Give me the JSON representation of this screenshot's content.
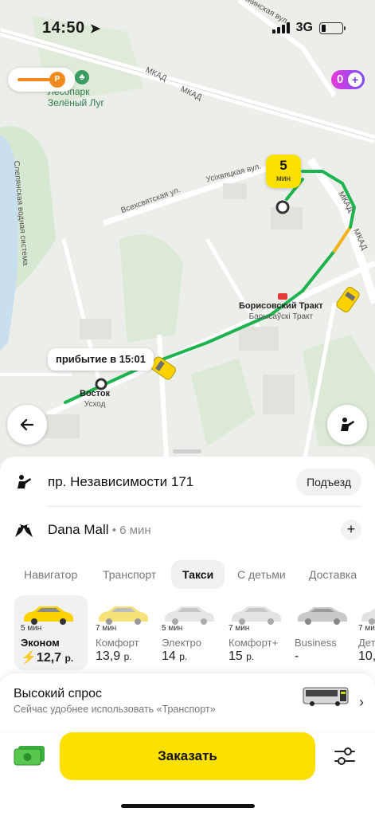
{
  "status": {
    "time": "14:50",
    "network": "3G"
  },
  "map": {
    "park_name_line1": "Лесопарк",
    "park_name_line2": "Зелёный Луг",
    "road_labels": {
      "mkad1": "МКАД",
      "mkad2": "МКАД",
      "mkad3": "МКАД",
      "mkad4": "МКАД",
      "usikh": "Усіхвяцкая вул.",
      "vsekh": "Всехсвятская ул.",
      "slep": "Слепянская водная система",
      "top_street": "Минская вул."
    },
    "parking_badge": "Р",
    "plus_count": "0",
    "eta_bubble": {
      "value": "5",
      "unit": "мин"
    },
    "arrival": "прибытие в 15:01",
    "stops": {
      "vostok": "Восток",
      "vostok_sub": "Усход",
      "borisov": "Борисовский Тракт",
      "borisov_sub": "Барысаўскі Тракт"
    },
    "colors": {
      "route_green": "#1db34f",
      "route_orange": "#f2b218",
      "taxi_yellow": "#fce000"
    }
  },
  "sheet": {
    "from_address": "пр. Независимости 171",
    "entrance_button": "Подъезд",
    "to_address": "Dana Mall",
    "to_eta": " • 6 мин",
    "tabs": [
      {
        "label": "Навигатор",
        "active": false
      },
      {
        "label": "Транспорт",
        "active": false
      },
      {
        "label": "Такси",
        "active": true
      },
      {
        "label": "С детьми",
        "active": false
      },
      {
        "label": "Доставка",
        "active": false
      }
    ],
    "tariffs": [
      {
        "eta": "5 мин",
        "name": "Эконом",
        "price": "12,7",
        "currency": "р.",
        "active": true,
        "surge": "⚡"
      },
      {
        "eta": "7 мин",
        "name": "Комфорт",
        "price": "13,9",
        "currency": "р.",
        "active": false
      },
      {
        "eta": "5 мин",
        "name": "Электро",
        "price": "14",
        "currency": "р.",
        "active": false
      },
      {
        "eta": "7 мин",
        "name": "Комфорт+",
        "price": "15",
        "currency": "р.",
        "active": false
      },
      {
        "eta": "",
        "name": "Business",
        "price": "-",
        "currency": "",
        "active": false
      },
      {
        "eta": "7 мин",
        "name": "Дет",
        "price": "10,",
        "currency": "",
        "active": false
      }
    ],
    "demand": {
      "title": "Высокий спрос",
      "subtitle": "Сейчас удобнее использовать «Транспорт»"
    },
    "order_button": "Заказать"
  }
}
